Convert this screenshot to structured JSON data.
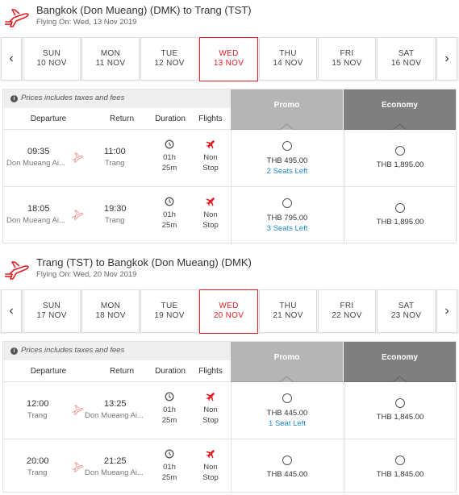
{
  "legs": [
    {
      "title": "Bangkok (Don Mueang) (DMK) to Trang (TST)",
      "subtitle": "Flying On: Wed, 13 Nov 2019",
      "nav_prev": "‹",
      "nav_next": "›",
      "days": [
        {
          "name": "SUN",
          "date": "10 NOV",
          "selected": false
        },
        {
          "name": "MON",
          "date": "11 NOV",
          "selected": false
        },
        {
          "name": "TUE",
          "date": "12 NOV",
          "selected": false
        },
        {
          "name": "WED",
          "date": "13 NOV",
          "selected": true
        },
        {
          "name": "THU",
          "date": "14 NOV",
          "selected": false
        },
        {
          "name": "FRI",
          "date": "15 NOV",
          "selected": false
        },
        {
          "name": "SAT",
          "date": "16 NOV",
          "selected": false
        }
      ],
      "info": "Prices includes taxes and fees",
      "columns": {
        "departure": "Departure",
        "return": "Return",
        "duration": "Duration",
        "flights": "Flights"
      },
      "fare_headers": {
        "promo": "Promo",
        "economy": "Economy"
      },
      "flights": [
        {
          "dep_time": "09:35",
          "dep_place": "Don Mueang Ai...",
          "arr_time": "11:00",
          "arr_place": "Trang",
          "dur_h": "01h",
          "dur_m": "25m",
          "stops_1": "Non",
          "stops_2": "Stop",
          "promo_price": "THB 495.00",
          "promo_seats": "2 Seats Left",
          "eco_price": "THB 1,895.00"
        },
        {
          "dep_time": "18:05",
          "dep_place": "Don Mueang Ai...",
          "arr_time": "19:30",
          "arr_place": "Trang",
          "dur_h": "01h",
          "dur_m": "25m",
          "stops_1": "Non",
          "stops_2": "Stop",
          "promo_price": "THB 795.00",
          "promo_seats": "3 Seats Left",
          "eco_price": "THB 1,895.00"
        }
      ]
    },
    {
      "title": "Trang (TST) to Bangkok (Don Mueang) (DMK)",
      "subtitle": "Flying On: Wed, 20 Nov 2019",
      "nav_prev": "‹",
      "nav_next": "›",
      "days": [
        {
          "name": "SUN",
          "date": "17 NOV",
          "selected": false
        },
        {
          "name": "MON",
          "date": "18 NOV",
          "selected": false
        },
        {
          "name": "TUE",
          "date": "19 NOV",
          "selected": false
        },
        {
          "name": "WED",
          "date": "20 NOV",
          "selected": true
        },
        {
          "name": "THU",
          "date": "21 NOV",
          "selected": false
        },
        {
          "name": "FRI",
          "date": "22 NOV",
          "selected": false
        },
        {
          "name": "SAT",
          "date": "23 NOV",
          "selected": false
        }
      ],
      "info": "Prices includes taxes and fees",
      "columns": {
        "departure": "Departure",
        "return": "Return",
        "duration": "Duration",
        "flights": "Flights"
      },
      "fare_headers": {
        "promo": "Promo",
        "economy": "Economy"
      },
      "flights": [
        {
          "dep_time": "12:00",
          "dep_place": "Trang",
          "arr_time": "13:25",
          "arr_place": "Don Mueang Ai...",
          "dur_h": "01h",
          "dur_m": "25m",
          "stops_1": "Non",
          "stops_2": "Stop",
          "promo_price": "THB 445.00",
          "promo_seats": "1 Seat Left",
          "eco_price": "THB 1,845.00"
        },
        {
          "dep_time": "20:00",
          "dep_place": "Trang",
          "arr_time": "21:25",
          "arr_place": "Don Mueang Ai...",
          "dur_h": "01h",
          "dur_m": "25m",
          "stops_1": "Non",
          "stops_2": "Stop",
          "promo_price": "THB 445.00",
          "promo_seats": "",
          "eco_price": "THB 1,845.00"
        }
      ]
    }
  ],
  "colors": {
    "accent": "#e31e24",
    "seats": "#1e88c9",
    "promo_header": "#b5b5b5",
    "economy_header": "#7f7f7f"
  }
}
